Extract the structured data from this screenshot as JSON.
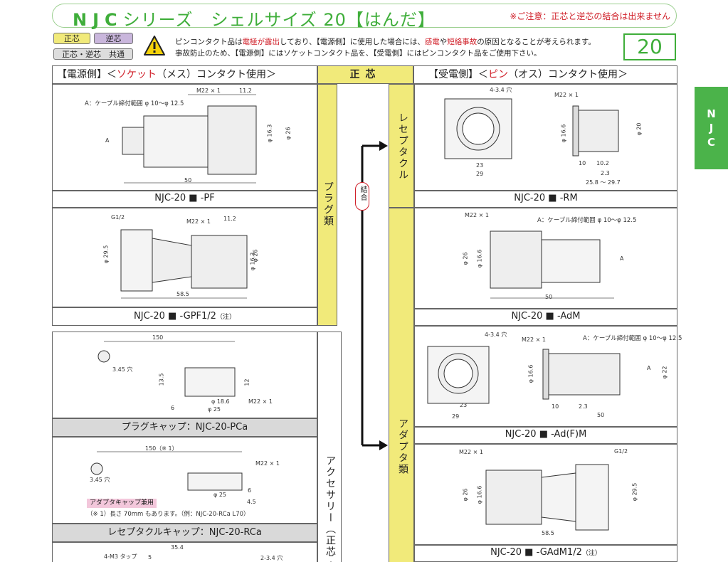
{
  "title": {
    "brand": "NJC",
    "series": "シリーズ　シェルサイズ 20【はんだ】",
    "note": "※ご注意：正芯と逆芯の結合は出来ません"
  },
  "legend": {
    "seishin": "正芯",
    "gyakushin": "逆芯",
    "both": "正芯・逆芯　共通"
  },
  "warning": {
    "line1_a": "ピンコンタクト品は",
    "line1_red1": "電極が露出",
    "line1_b": "しており、【電源側】に使用した場合には、",
    "line1_red2": "感電",
    "line1_c": "や",
    "line1_red3": "短絡事故",
    "line1_d": "の原因となることが考えられます。",
    "line2": "事故防止のため、【電源側】にはソケットコンタクト品を、【受電側】にはピンコンタクト品をご使用下さい。"
  },
  "size_badge": "20",
  "side_tab": [
    "N",
    "J",
    "C"
  ],
  "headers": {
    "left_a": "【電源側】＜",
    "left_red": "ソケット",
    "left_b": "（メス）コンタクト使用＞",
    "mid": "正芯",
    "right_a": "【受電側】＜",
    "right_red": "ピン",
    "right_b": "（オス）コンタクト使用＞"
  },
  "vertical_labels": {
    "plug": "プラグ類",
    "receptacle": "レセプタクル",
    "adaptor": "アダプタ類",
    "accessory": "アクセサリー（正芯・",
    "connect": "結合"
  },
  "products": {
    "pf": {
      "caption_a": "NJC-20",
      "caption_b": "-PF",
      "cable_note": "A：ケーブル締付範囲 φ 10～φ 12.5",
      "dims": [
        "M22 × 1",
        "11.2",
        "φ 16.3",
        "φ 26",
        "A",
        "50"
      ]
    },
    "gpf": {
      "caption_a": "NJC-20",
      "caption_b": "-GPF1/2",
      "caption_note": "（注）",
      "dims": [
        "G1/2",
        "M22 × 1",
        "11.2",
        "φ 29.5",
        "φ 16.3",
        "φ 26",
        "58.5"
      ]
    },
    "rm": {
      "caption_a": "NJC-20",
      "caption_b": "-RM",
      "dims": [
        "4-3.4 穴",
        "M22 × 1",
        "23",
        "29",
        "φ 16.6",
        "φ 20",
        "10",
        "10.2",
        "2.3",
        "25.8 ～ 29.7"
      ]
    },
    "adm": {
      "caption_a": "NJC-20",
      "caption_b": "-AdM",
      "cable_note": "A：ケーブル締付範囲 φ 10～φ 12.5",
      "dims": [
        "M22 × 1",
        "φ 26",
        "φ 16.6",
        "A",
        "50"
      ]
    },
    "adfm": {
      "caption_a": "NJC-20",
      "caption_b": "-Ad(F)M",
      "cable_note": "A：ケーブル締付範囲 φ 10～φ 12.5",
      "dims": [
        "4-3.4 穴",
        "M22 × 1",
        "23",
        "29",
        "φ 16.6",
        "A",
        "φ 22",
        "10",
        "2.3",
        "50"
      ]
    },
    "gadm": {
      "caption_a": "NJC-20",
      "caption_b": "-GAdM1/2",
      "caption_note": "（注）",
      "dims": [
        "M22 × 1",
        "G1/2",
        "φ 26",
        "φ 16.6",
        "φ 29.5",
        "58.5"
      ]
    },
    "pca": {
      "caption": "プラグキャップ：NJC-20-PCa",
      "dims": [
        "150",
        "3.45 穴",
        "13.5",
        "12",
        "6",
        "φ 18.6",
        "φ 25",
        "M22 × 1"
      ]
    },
    "rca": {
      "caption": "レセプタクルキャップ：NJC-20-RCa",
      "tag": "アダプタキャップ兼用",
      "note": "（※ 1）長さ 70mm もあります。（例：NJC-20-RCa L70）",
      "dims": [
        "150（※ 1）",
        "3.45 穴",
        "M22 × 1",
        "φ 25",
        "6",
        "4.5"
      ]
    },
    "bottom": {
      "dims": [
        "4-M3 タップ",
        "35.4",
        "5",
        "2-3.4 穴"
      ]
    }
  },
  "colors": {
    "brand_green": "#3fae3a",
    "seishin_yellow": "#f1ea7a",
    "gyakushin_lavender": "#c9b6dc",
    "warning_red": "#d0202a"
  }
}
